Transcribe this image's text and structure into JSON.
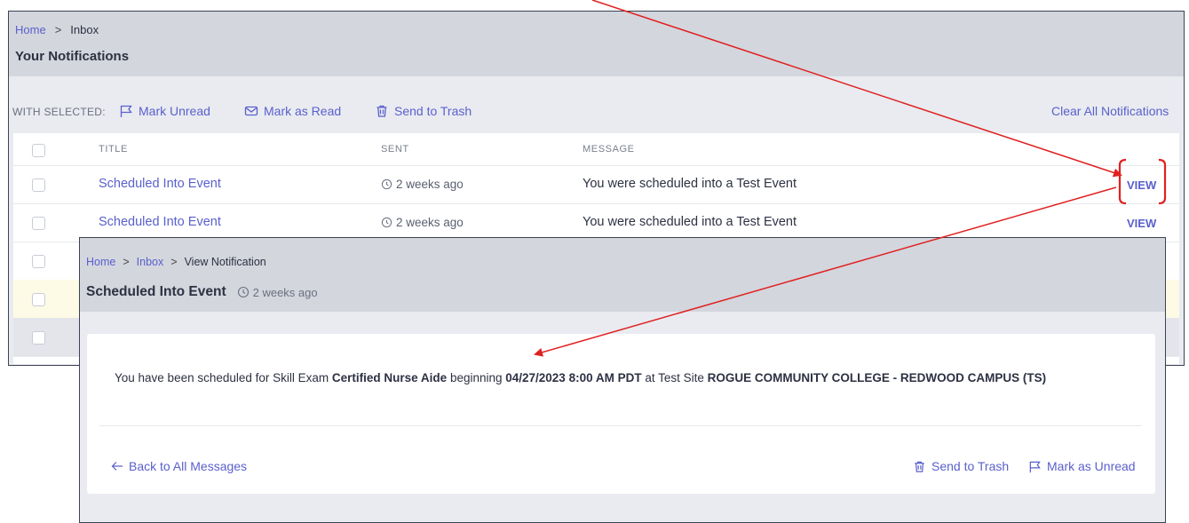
{
  "inbox": {
    "breadcrumb": {
      "home": "Home",
      "separator": ">",
      "current": "Inbox"
    },
    "title": "Your Notifications",
    "toolbar": {
      "with_selected": "WITH SELECTED:",
      "mark_unread": "Mark Unread",
      "mark_as_read": "Mark as Read",
      "send_to_trash": "Send to Trash",
      "clear_all": "Clear All Notifications"
    },
    "columns": {
      "title": "TITLE",
      "sent": "SENT",
      "message": "MESSAGE"
    },
    "rows": [
      {
        "title": "Scheduled Into Event",
        "sent": "2 weeks ago",
        "message": "You were scheduled into a Test Event",
        "action": "VIEW"
      },
      {
        "title": "Scheduled Into Event",
        "sent": "2 weeks ago",
        "message": "You were scheduled into a Test Event",
        "action": "VIEW"
      }
    ]
  },
  "detail": {
    "breadcrumb": {
      "home": "Home",
      "separator": ">",
      "inbox": "Inbox",
      "current": "View Notification"
    },
    "title": "Scheduled Into Event",
    "sent": "2 weeks ago",
    "message": {
      "part1": "You have been scheduled for Skill Exam ",
      "exam": "Certified Nurse Aide",
      "part2": " beginning ",
      "datetime": "04/27/2023 8:00 AM PDT",
      "part3": " at Test Site ",
      "site": "ROGUE COMMUNITY COLLEGE - REDWOOD CAMPUS (TS)"
    },
    "back": "Back to All Messages",
    "send_to_trash": "Send to Trash",
    "mark_as_unread": "Mark as Unread"
  },
  "colors": {
    "link": "#5a60cc",
    "header": "#d3d6dd",
    "highlight_row": "#fdfbe5",
    "annotation": "#e02020"
  },
  "icons": [
    "flag-icon",
    "envelope-icon",
    "trash-icon",
    "clock-icon",
    "arrow-left-icon"
  ]
}
